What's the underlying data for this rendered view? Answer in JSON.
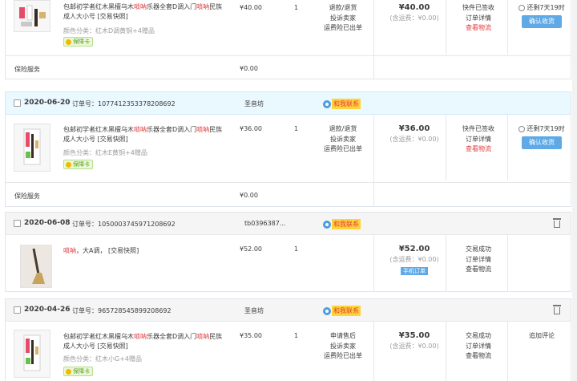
{
  "orders": [
    {
      "title_pre": "包邮初学者红木黑檀乌木",
      "title_hl1": "唢呐",
      "title_mid": "乐器全套D调入门",
      "title_hl2": "唢呐",
      "title_post": "民族成人大小号 [交易快照]",
      "sku": "颜色分类：红木D调黄铜+4赠品",
      "badge": "保障卡",
      "price": "¥40.00",
      "qty": "1",
      "services": [
        "退款/退货",
        "投诉卖家",
        "运费险已出单"
      ],
      "total": "¥40.00",
      "shipping": "(含运费：¥0.00)",
      "status": [
        "快件已签收",
        "订单详情",
        "查看物流"
      ],
      "timer": "还剩7天19时",
      "confirm": "确认收货",
      "insurance_label": "保险服务",
      "insurance_price": "¥0.00"
    },
    {
      "date": "2020-06-20",
      "order_no": "订单号：1077412353378208692",
      "seller": "圣音坊",
      "wangwang": "和我联系",
      "title_pre": "包邮初学者红木黑檀乌木",
      "title_hl1": "唢呐",
      "title_mid": "乐器全套D调入门",
      "title_hl2": "唢呐",
      "title_post": "民族成人大小号 [交易快照]",
      "sku": "颜色分类：红木E黄铜+4赠品",
      "badge": "保障卡",
      "price": "¥36.00",
      "qty": "1",
      "services": [
        "退款/退货",
        "投诉卖家",
        "运费险已出单"
      ],
      "total": "¥36.00",
      "shipping": "(含运费：¥0.00)",
      "status": [
        "快件已签收",
        "订单详情",
        "查看物流"
      ],
      "timer": "还剩7天19时",
      "confirm": "确认收货",
      "insurance_label": "保险服务",
      "insurance_price": "¥0.00"
    },
    {
      "date": "2020-06-08",
      "order_no": "订单号：1050003745971208692",
      "seller": "tb0396387...",
      "wangwang": "和我联系",
      "title_hl1": "唢呐",
      "title_post": "，大A调， [交易快照]",
      "price": "¥52.00",
      "qty": "1",
      "total": "¥52.00",
      "shipping": "(含运费：¥0.00)",
      "tag": "手机订单",
      "status": [
        "交易成功",
        "订单详情",
        "查看物流"
      ]
    },
    {
      "date": "2020-04-26",
      "order_no": "订单号：965728545899208692",
      "seller": "圣音坊",
      "wangwang": "和我联系",
      "title_pre": "包邮初学者红木黑檀乌木",
      "title_hl1": "唢呐",
      "title_mid": "乐器全套D调入门",
      "title_hl2": "唢呐",
      "title_post": "民族成人大小号 [交易快照]",
      "sku": "颜色分类：红木小G+4赠品",
      "badge": "保障卡",
      "price": "¥35.00",
      "qty": "1",
      "services": [
        "申请售后",
        "投诉卖家",
        "运费险已出单"
      ],
      "total": "¥35.00",
      "shipping": "(含运费：¥0.00)",
      "status": [
        "交易成功",
        "订单详情",
        "查看物流"
      ],
      "action": "追加评论"
    }
  ]
}
